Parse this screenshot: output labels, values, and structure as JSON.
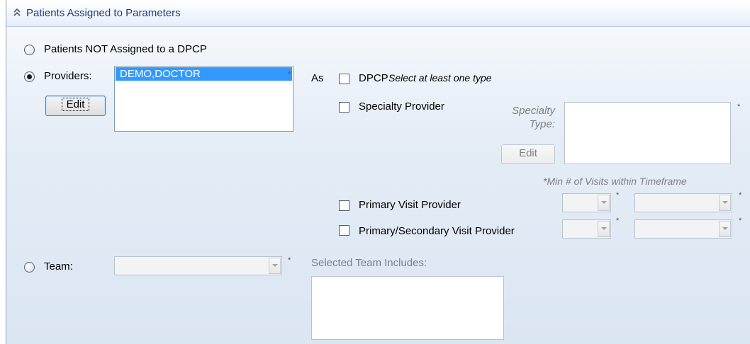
{
  "header": {
    "title": "Patients Assigned to Parameters",
    "icon": "double-chevron-up-icon"
  },
  "options": {
    "not_assigned_label": "Patients NOT Assigned to a DPCP",
    "providers_label": "Providers:",
    "team_label": "Team:",
    "selected_option": "providers"
  },
  "providers": {
    "list": [
      "DEMO,DOCTOR"
    ],
    "edit_label": "Edit",
    "required_mark": "*"
  },
  "as_label": "As",
  "types": {
    "dpcp_label": "DPCP",
    "dpcp_hint": "Select at least one type",
    "specialty_label": "Specialty Provider",
    "specialty_type_label_1": "Specialty",
    "specialty_type_label_2": "Type:",
    "specialty_edit_label": "Edit",
    "specialty_required": "*",
    "min_visits_label": "*Min # of Visits within Timeframe",
    "primary_visit_label": "Primary Visit Provider",
    "primary_secondary_label": "Primary/Secondary Visit Provider",
    "required_mark": "*"
  },
  "team": {
    "required_mark": "*",
    "includes_label": "Selected Team Includes:"
  },
  "colors": {
    "header_text": "#1f3f7a",
    "selection": "#3399ff",
    "panel_bg": "#dbe6f3"
  }
}
